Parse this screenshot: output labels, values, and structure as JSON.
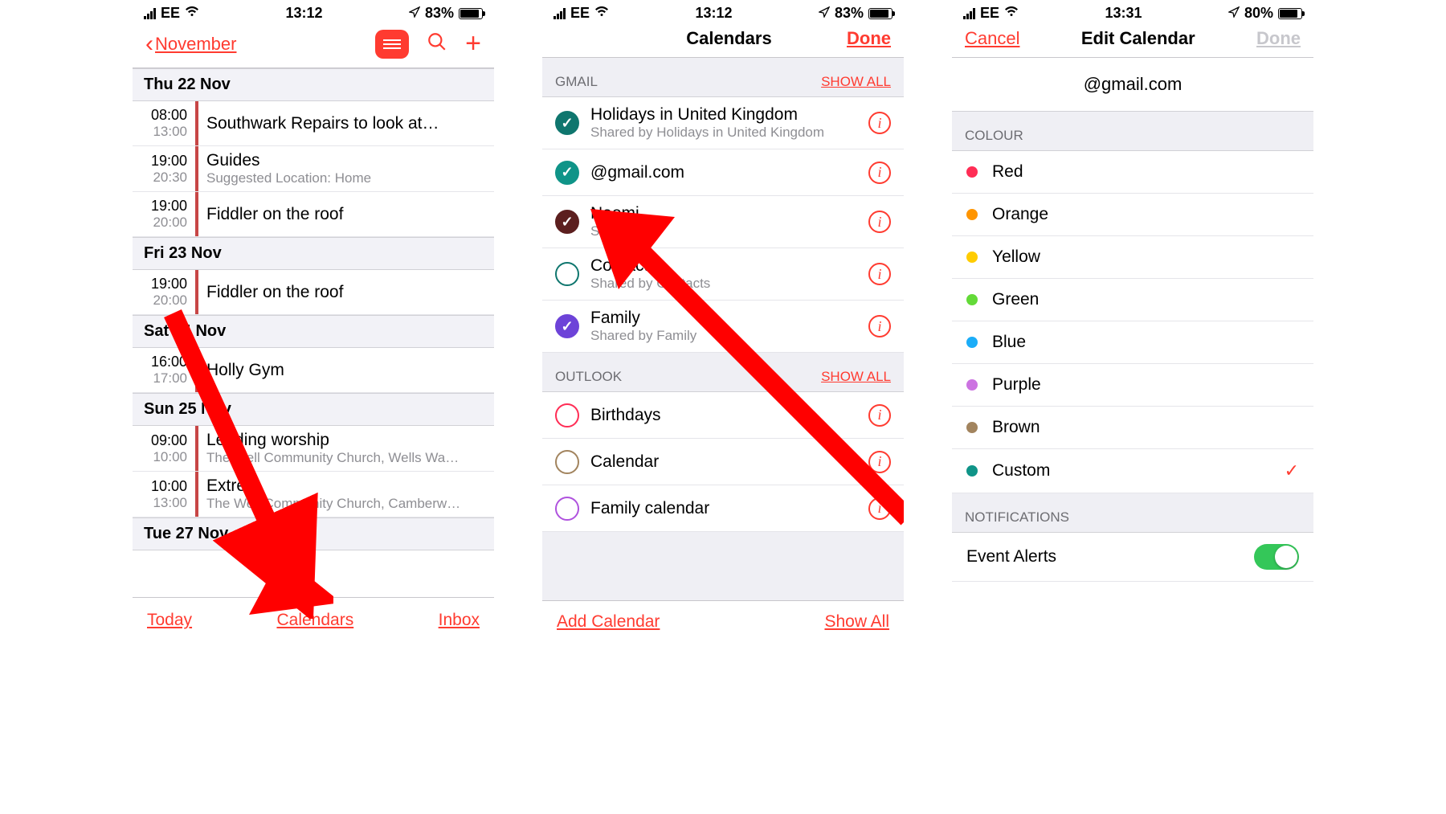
{
  "screen1": {
    "status": {
      "carrier": "EE",
      "time": "13:12",
      "batt": "83%",
      "batt_pct": 83
    },
    "nav_back": "November",
    "days": [
      {
        "label": "Thu  22 Nov",
        "events": [
          {
            "start": "08:00",
            "end": "13:00",
            "title": "Southwark Repairs to look at…"
          },
          {
            "start": "19:00",
            "end": "20:30",
            "title": "Guides",
            "sub": "Suggested Location: Home"
          },
          {
            "start": "19:00",
            "end": "20:00",
            "title": "Fiddler on the roof"
          }
        ]
      },
      {
        "label": "Fri  23 Nov",
        "events": [
          {
            "start": "19:00",
            "end": "20:00",
            "title": "Fiddler on the roof"
          }
        ]
      },
      {
        "label": "Sat  24 Nov",
        "events": [
          {
            "start": "16:00",
            "end": "17:00",
            "title": "Holly Gym"
          }
        ]
      },
      {
        "label": "Sun  25 Nov",
        "events": [
          {
            "start": "09:00",
            "end": "10:00",
            "title": "Leading worship",
            "sub": "The Well Community Church, Wells Wa…"
          },
          {
            "start": "10:00",
            "end": "13:00",
            "title": "Extre",
            "sub": "The Well Community Church, Camberw…"
          }
        ]
      },
      {
        "label": "Tue  27 Nov",
        "events": []
      }
    ],
    "toolbar": {
      "today": "Today",
      "calendars": "Calendars",
      "inbox": "Inbox"
    }
  },
  "screen2": {
    "status": {
      "carrier": "EE",
      "time": "13:12",
      "batt": "83%",
      "batt_pct": 83
    },
    "title": "Calendars",
    "done": "Done",
    "sections": [
      {
        "name": "GMAIL",
        "showall": "SHOW ALL",
        "items": [
          {
            "title": "Holidays in United Kingdom",
            "sub": "Shared by Holidays in United Kingdom",
            "color": "#0f766e",
            "checked": true
          },
          {
            "title": "@gmail.com",
            "color": "#0f9488",
            "checked": true
          },
          {
            "title": "Naomi",
            "sub": "Sha",
            "color": "#5c1f1f",
            "checked": true
          },
          {
            "title": "Contacts",
            "sub": "Shared by Contacts",
            "color": "#0f766e",
            "checked": false
          },
          {
            "title": "Family",
            "sub": "Shared by Family",
            "color": "#6d43d8",
            "checked": true
          }
        ]
      },
      {
        "name": "OUTLOOK",
        "showall": "SHOW ALL",
        "items": [
          {
            "title": "Birthdays",
            "color": "#ff2d55",
            "checked": false
          },
          {
            "title": "Calendar",
            "color": "#a2845e",
            "checked": false
          },
          {
            "title": "Family calendar",
            "color": "#af52de",
            "checked": false
          }
        ]
      }
    ],
    "bottom": {
      "add": "Add Calendar",
      "showall": "Show All"
    }
  },
  "screen3": {
    "status": {
      "carrier": "EE",
      "time": "13:31",
      "batt": "80%",
      "batt_pct": 80
    },
    "cancel": "Cancel",
    "title": "Edit Calendar",
    "done": "Done",
    "email": "@gmail.com",
    "colour_header": "COLOUR",
    "colours": [
      {
        "label": "Red",
        "color": "#ff2d55"
      },
      {
        "label": "Orange",
        "color": "#ff9500"
      },
      {
        "label": "Yellow",
        "color": "#ffcc00"
      },
      {
        "label": "Green",
        "color": "#63da38"
      },
      {
        "label": "Blue",
        "color": "#1badf8"
      },
      {
        "label": "Purple",
        "color": "#cc73e1"
      },
      {
        "label": "Brown",
        "color": "#a2845e"
      },
      {
        "label": "Custom",
        "color": "#0f9488",
        "selected": true
      }
    ],
    "notif_header": "NOTIFICATIONS",
    "event_alerts": "Event Alerts"
  }
}
